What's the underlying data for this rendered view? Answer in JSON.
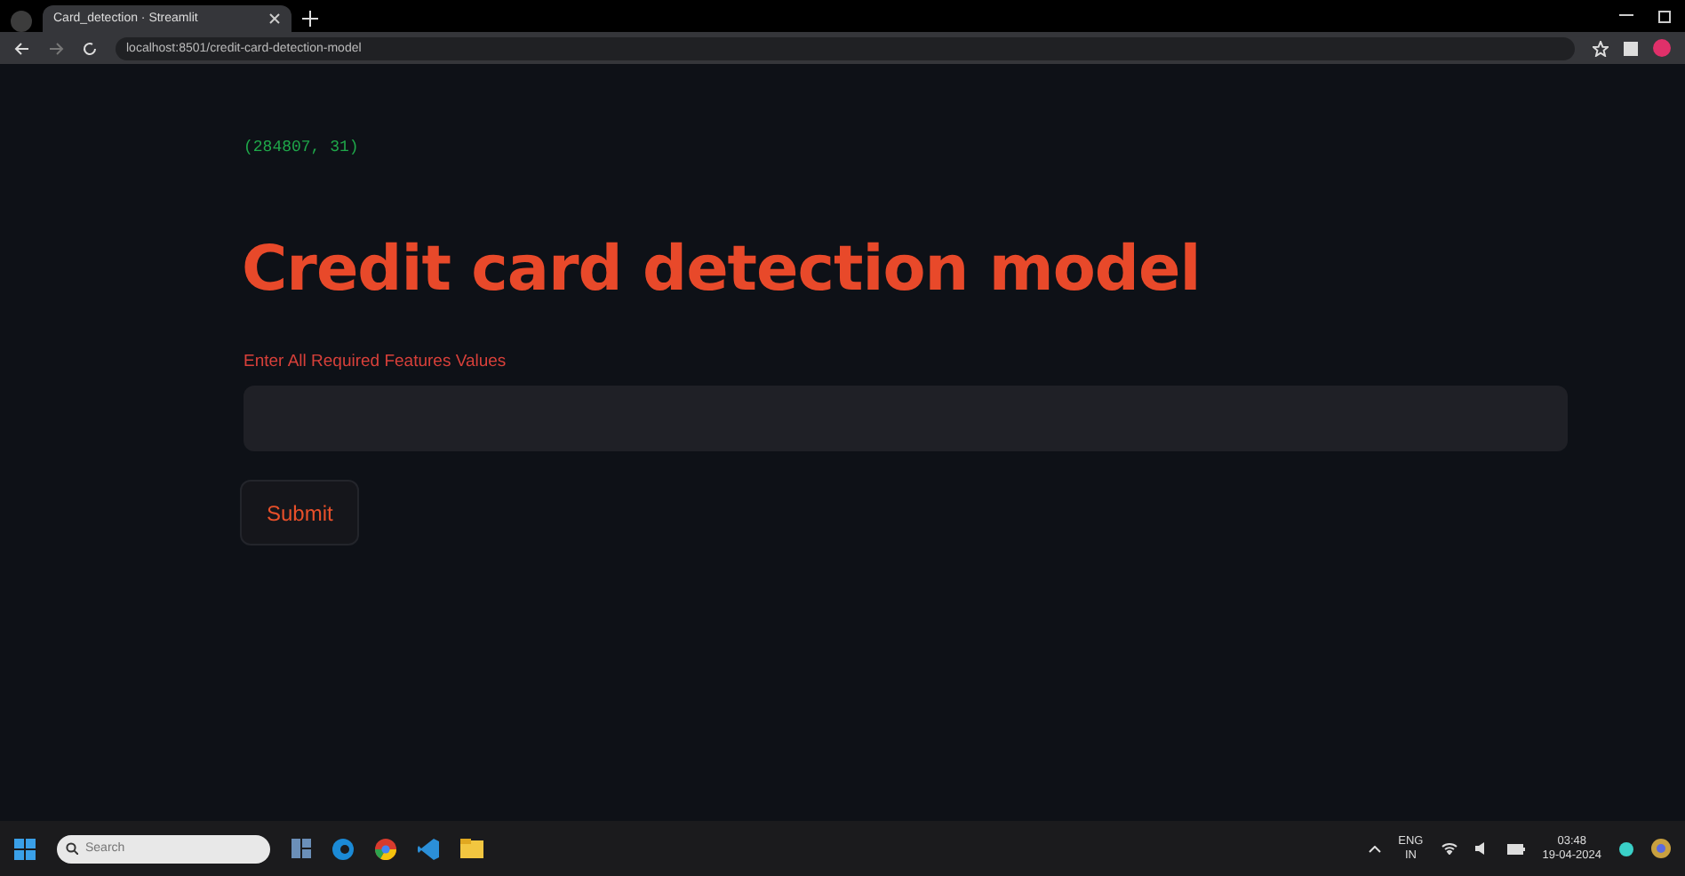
{
  "browser": {
    "tab": {
      "title": "Card_detection · Streamlit",
      "selected": true
    },
    "address": "localhost:8501/credit-card-detection-model"
  },
  "page": {
    "shape_output": "(284807, 31)",
    "title": "Credit card detection model",
    "field_label": "Enter All Required Features Values",
    "button": "Submit"
  },
  "taskbar": {
    "search": {
      "placeholder": "Search"
    },
    "language": [
      "ENG",
      "IN"
    ],
    "time": "03:48",
    "date": "19-04-2024"
  }
}
